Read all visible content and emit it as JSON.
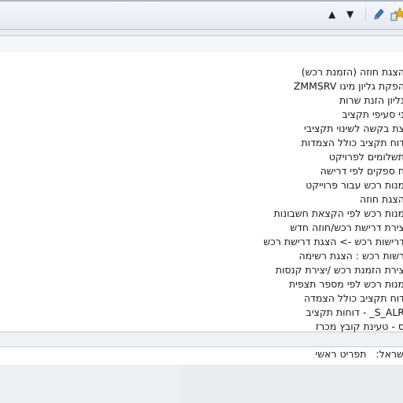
{
  "toolbar": {
    "up_label": "▲",
    "down_label": "▼"
  },
  "menu": {
    "items": [
      "הצגת חוזה (הזמנת רכש)",
      "הפקת גליון מיגו ZMMSRV",
      "גליון הזנת שרות",
      "ני סעיפי תקציב",
      "צת בקשה לשינוי תקציבי",
      "דוח תקציב כולל הצמדות",
      "תשלומים לפרויקט",
      "ח ספקים לפי דרישה",
      "מנות רכש עבור פרוייקט",
      "הצגת חוזה",
      "מנות רכש לפי הקצאת חשבונות",
      "צירת דרישת רכש/חוזה חדש",
      "דרישות רכש -> הצגת דרישת רכש",
      "רשות רכש : הצגת רשימה",
      "צירת הזמנת רכש /יצירת קנסות",
      "מנות רכש לפי מספר תצפית",
      "דוח תקציב כולל הצמדה",
      "S_ALR_ - דוחות תקציב",
      "ס - טעינת קובץ מכרז"
    ]
  },
  "status": {
    "label": "שראל:",
    "value": "תפריט ראשי"
  },
  "colors": {
    "toolbar_bg": "#e3e9f0",
    "panel_bg": "#ffffff",
    "page_bg": "#e9edf2",
    "accent": "#2b5fa8",
    "star": "#f2b01e"
  },
  "icons": [
    "move-up-icon",
    "move-down-icon",
    "edit-pencil-icon",
    "favorites-star-icon"
  ]
}
